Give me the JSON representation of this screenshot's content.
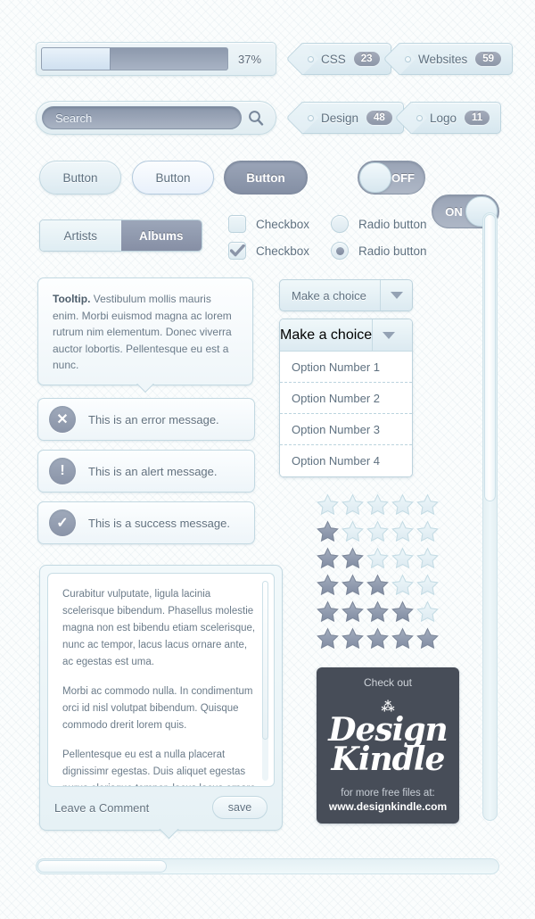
{
  "progress": {
    "percent_label": "37%",
    "value": 37
  },
  "tags": [
    {
      "label": "CSS",
      "count": "23"
    },
    {
      "label": "Websites",
      "count": "59"
    },
    {
      "label": "Design",
      "count": "48"
    },
    {
      "label": "Logo",
      "count": "11"
    }
  ],
  "search": {
    "placeholder": "Search",
    "icon": "search-icon"
  },
  "buttons": [
    {
      "label": "Button",
      "state": "normal"
    },
    {
      "label": "Button",
      "state": "hover"
    },
    {
      "label": "Button",
      "state": "active"
    }
  ],
  "toggles": [
    {
      "label": "OFF",
      "state": "off"
    },
    {
      "label": "ON",
      "state": "on"
    }
  ],
  "segmented": {
    "tabs": [
      "Artists",
      "Albums"
    ],
    "selected": "Albums"
  },
  "checkboxes": [
    {
      "label": "Checkbox",
      "checked": false
    },
    {
      "label": "Checkbox",
      "checked": true
    }
  ],
  "radios": [
    {
      "label": "Radio button",
      "checked": false
    },
    {
      "label": "Radio button",
      "checked": true
    }
  ],
  "tooltip": {
    "lead": "Tooltip.",
    "body": " Vestibulum mollis mauris enim. Morbi euismod magna ac lorem rutrum nim elementum. Donec viverra auctor lobortis. Pellentesque eu est a nunc."
  },
  "messages": [
    {
      "type": "error",
      "icon": "close-icon",
      "glyph": "✕",
      "text": "This is an error message."
    },
    {
      "type": "alert",
      "icon": "exclamation-icon",
      "glyph": "!",
      "text": "This is an alert message."
    },
    {
      "type": "success",
      "icon": "check-icon",
      "glyph": "✓",
      "text": "This is a success message."
    }
  ],
  "dropdown_closed": {
    "value": "Make a choice",
    "caret": "chevron-down-icon"
  },
  "dropdown_open": {
    "value": "Make a choice",
    "caret": "chevron-down-icon",
    "options": [
      "Option Number 1",
      "Option Number 2",
      "Option Number 3",
      "Option Number 4"
    ]
  },
  "ratings": [
    0,
    1,
    2,
    3,
    4,
    5
  ],
  "comment": {
    "paragraphs": [
      "Curabitur vulputate, ligula lacinia scelerisque bibendum. Phasellus molestie magna non est bibendu etiam scelerisque, nunc ac tempor, lacus lacus ornare ante, ac egestas est uma.",
      "Morbi ac commodo nulla. In condimentum orci id nisl volutpat bibendum. Quisque commodo drerit lorem quis.",
      "Pellentesque eu est a nulla placerat dignissimr egestas. Duis aliquet egestas purus elerisque tempor, lacus lacus ornare antac."
    ],
    "footer_label": "Leave a Comment",
    "save_label": "save"
  },
  "banner": {
    "top": "Check out",
    "logo_line1": "Design",
    "logo_line2": "Kindle",
    "bottom_line1": "for more free files at:",
    "bottom_line2": "www.designkindle.com"
  },
  "colors": {
    "accent_dark": "#8a94a8",
    "accent_light": "#dceaf1",
    "border": "#c3d9e2",
    "text": "#5f7180",
    "banner_bg": "#474d58"
  }
}
